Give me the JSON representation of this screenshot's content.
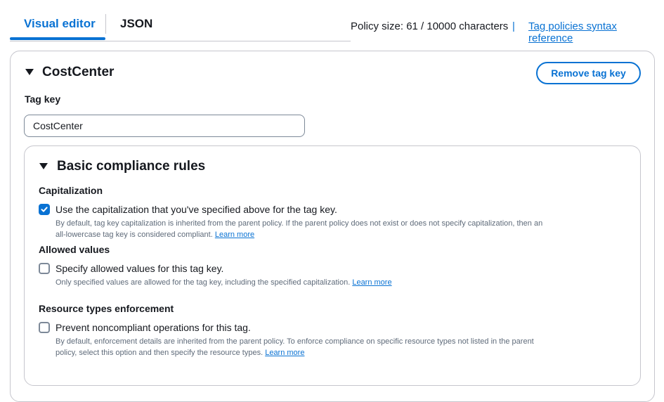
{
  "tabs": [
    {
      "label": "Visual editor",
      "active": true
    },
    {
      "label": "JSON",
      "active": false
    }
  ],
  "policy_size_text": "Policy size: 61 / 10000 characters",
  "separator": "|",
  "syntax_link": "Tag policies syntax reference",
  "tag_section": {
    "title": "CostCenter",
    "remove_button": "Remove tag key",
    "tag_key_label": "Tag key",
    "tag_key_value": "CostCenter"
  },
  "compliance": {
    "title": "Basic compliance rules",
    "capitalization": {
      "heading": "Capitalization",
      "checked": true,
      "label": "Use the capitalization that you've specified above for the tag key.",
      "desc_line1": "By default, tag key capitalization is inherited from the parent policy. If the parent policy does not exist or does not specify capitalization, then an",
      "desc_line2": "all-lowercase tag key is considered compliant.",
      "learn_more": "Learn more"
    },
    "allowed_values": {
      "heading": "Allowed values",
      "checked": false,
      "label": "Specify allowed values for this tag key.",
      "desc_line1": "Only specified values are allowed for the tag key, including the specified capitalization.",
      "learn_more": "Learn more"
    },
    "enforcement": {
      "heading": "Resource types enforcement",
      "checked": false,
      "label": "Prevent noncompliant operations for this tag.",
      "desc_line1": "By default, enforcement details are inherited from the parent policy. To enforce compliance on specific resource types not listed in the parent",
      "desc_line2": "policy, select this option and then specify the resource types.",
      "learn_more": "Learn more"
    }
  },
  "colors": {
    "accent": "#0972d3",
    "text": "#16191f",
    "muted": "#5f6b7a",
    "border": "#c6c6cd"
  }
}
